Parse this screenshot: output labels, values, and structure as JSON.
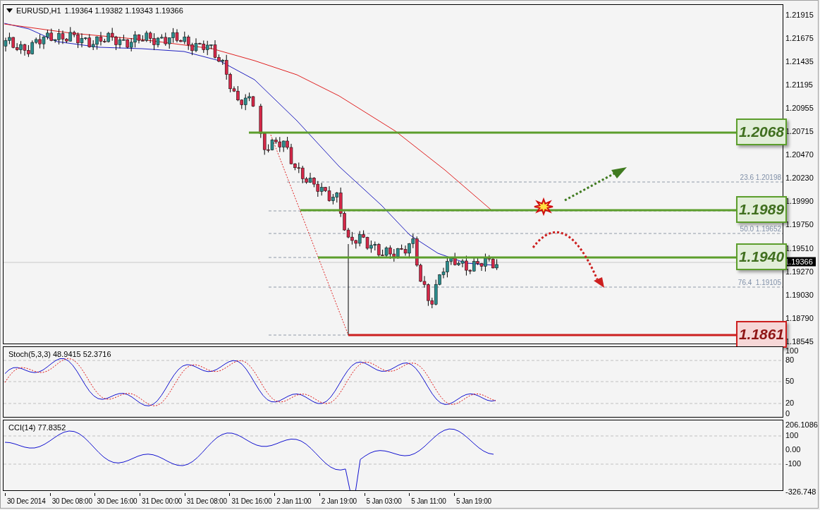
{
  "chart": {
    "header": {
      "symbol": "EURUSD,H1",
      "quote": "1.19364 1.19382 1.19343 1.19366"
    },
    "price_axis": {
      "ticks": [
        "1.21915",
        "1.21675",
        "1.21435",
        "1.21195",
        "1.20955",
        "1.20715",
        "1.20470",
        "1.20230",
        "1.19990",
        "1.19750",
        "1.19510",
        "1.19270",
        "1.19030",
        "1.18790",
        "1.18545"
      ],
      "current_price": "1.19366"
    },
    "fib_levels": [
      {
        "label": "23.6 1.20198"
      },
      {
        "label": "50.0 1.19652"
      },
      {
        "label": "76.4  1.19105"
      }
    ],
    "levels": [
      {
        "label": "1.2068",
        "color": "#5c9e2c"
      },
      {
        "label": "1.1989",
        "color": "#5c9e2c"
      },
      {
        "label": "1.1940",
        "color": "#5c9e2c"
      },
      {
        "label": "1.1861",
        "color": "#cc1f1f"
      }
    ]
  },
  "stochastic": {
    "label": "Stoch(5,3,3) 48.9415 52.3716",
    "ticks": [
      "100",
      "80",
      "50",
      "20",
      "0"
    ]
  },
  "cci": {
    "label": "CCI(14) 77.8352",
    "ticks": [
      "206.1086",
      "100",
      "0.00",
      "-100",
      "-326.748"
    ]
  },
  "time_axis": [
    "30 Dec 2014",
    "30 Dec 08:00",
    "30 Dec 16:00",
    "31 Dec 00:00",
    "31 Dec 08:00",
    "31 Dec 16:00",
    "2 Jan 11:00",
    "2 Jan 19:00",
    "5 Jan 03:00",
    "5 Jan 11:00",
    "5 Jan 19:00"
  ]
}
